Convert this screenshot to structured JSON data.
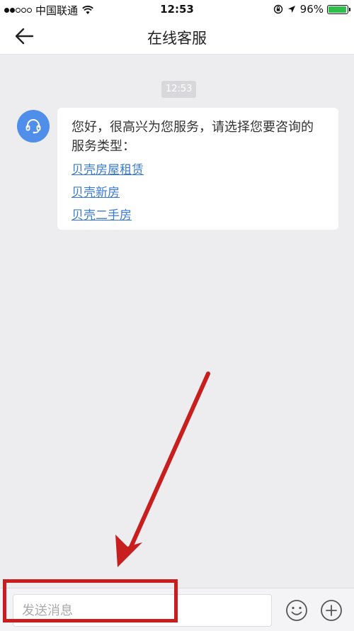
{
  "status_bar": {
    "carrier": "中国联通",
    "time": "12:53",
    "battery_percent": "96%",
    "battery_level": 0.96,
    "signal_bars_filled": 2,
    "signal_bars_total": 5
  },
  "nav": {
    "title": "在线客服"
  },
  "chat": {
    "timestamp": "12:53",
    "message": {
      "greeting": "您好，很高兴为您服务，请选择您要咨询的服务类型：",
      "options": [
        "贝壳房屋租赁",
        "贝壳新房",
        "贝壳二手房"
      ]
    }
  },
  "input_bar": {
    "placeholder": "发送消息"
  },
  "colors": {
    "avatar_bg": "#4f8fe9",
    "link": "#3a7bd0",
    "annotation": "#c81e1e",
    "battery_fill": "#2ec04a"
  }
}
